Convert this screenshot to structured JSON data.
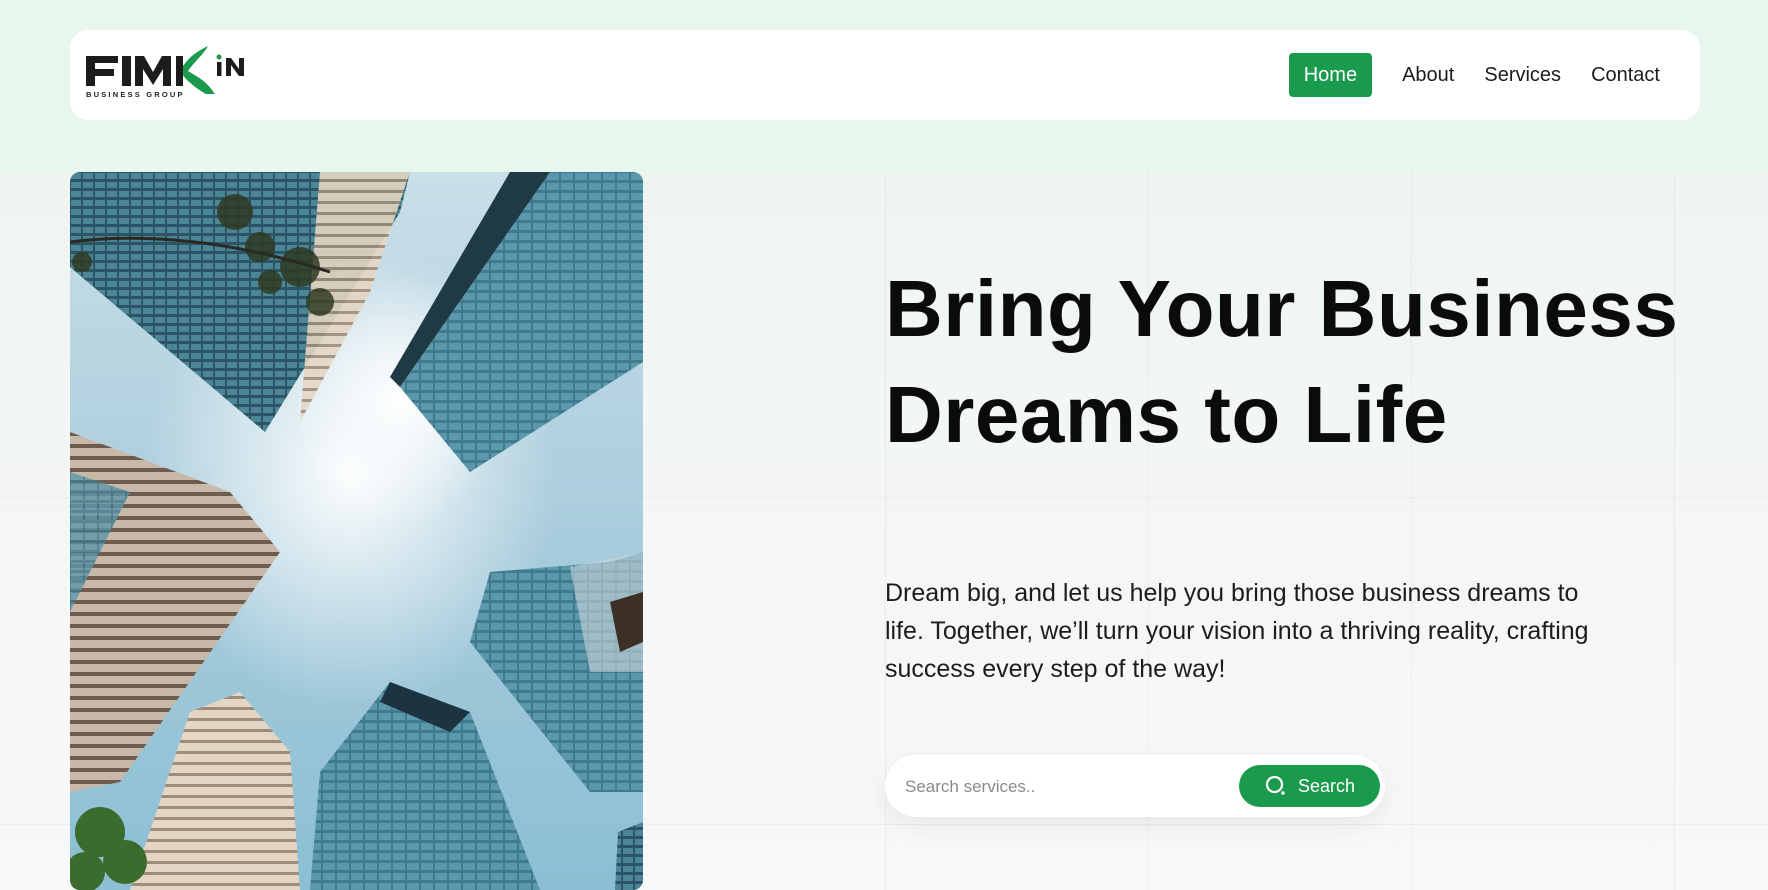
{
  "brand": {
    "logo_text": "FIMKiN",
    "logo_subtitle": "BUSINESS GROUP"
  },
  "nav": {
    "items": [
      {
        "label": "Home",
        "active": true
      },
      {
        "label": "About",
        "active": false
      },
      {
        "label": "Services",
        "active": false
      },
      {
        "label": "Contact",
        "active": false
      }
    ]
  },
  "hero": {
    "title": "Bring Your Business Dreams to Life",
    "description": "Dream big, and let us help you bring those business dreams to life. Together, we’ll turn your vision into a thriving reality, crafting success every step of the way!",
    "image_icon": "city-skyscrapers-image"
  },
  "search": {
    "placeholder": "Search services..",
    "value": "",
    "button_label": "Search",
    "button_icon": "search-icon"
  },
  "colors": {
    "accent": "#1a9a4c",
    "top_band": "#e8f7ee",
    "text": "#0b0b0b"
  }
}
